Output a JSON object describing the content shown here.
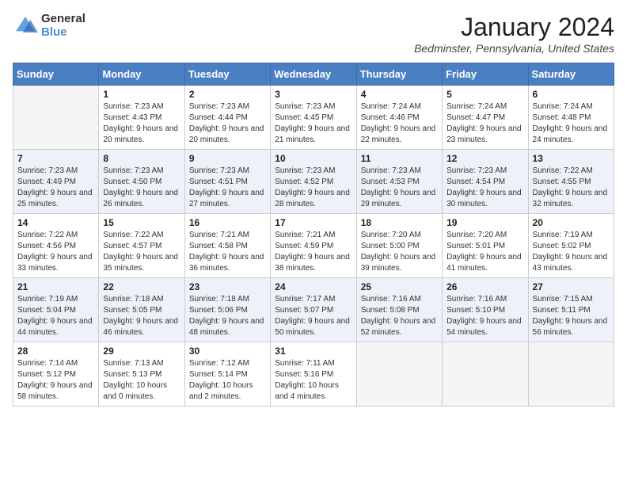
{
  "header": {
    "logo_general": "General",
    "logo_blue": "Blue",
    "month_title": "January 2024",
    "location": "Bedminster, Pennsylvania, United States"
  },
  "days_of_week": [
    "Sunday",
    "Monday",
    "Tuesday",
    "Wednesday",
    "Thursday",
    "Friday",
    "Saturday"
  ],
  "weeks": [
    [
      {
        "day": "",
        "sunrise": "",
        "sunset": "",
        "daylight": "",
        "empty": true
      },
      {
        "day": "1",
        "sunrise": "Sunrise: 7:23 AM",
        "sunset": "Sunset: 4:43 PM",
        "daylight": "Daylight: 9 hours and 20 minutes.",
        "empty": false
      },
      {
        "day": "2",
        "sunrise": "Sunrise: 7:23 AM",
        "sunset": "Sunset: 4:44 PM",
        "daylight": "Daylight: 9 hours and 20 minutes.",
        "empty": false
      },
      {
        "day": "3",
        "sunrise": "Sunrise: 7:23 AM",
        "sunset": "Sunset: 4:45 PM",
        "daylight": "Daylight: 9 hours and 21 minutes.",
        "empty": false
      },
      {
        "day": "4",
        "sunrise": "Sunrise: 7:24 AM",
        "sunset": "Sunset: 4:46 PM",
        "daylight": "Daylight: 9 hours and 22 minutes.",
        "empty": false
      },
      {
        "day": "5",
        "sunrise": "Sunrise: 7:24 AM",
        "sunset": "Sunset: 4:47 PM",
        "daylight": "Daylight: 9 hours and 23 minutes.",
        "empty": false
      },
      {
        "day": "6",
        "sunrise": "Sunrise: 7:24 AM",
        "sunset": "Sunset: 4:48 PM",
        "daylight": "Daylight: 9 hours and 24 minutes.",
        "empty": false
      }
    ],
    [
      {
        "day": "7",
        "sunrise": "Sunrise: 7:23 AM",
        "sunset": "Sunset: 4:49 PM",
        "daylight": "Daylight: 9 hours and 25 minutes.",
        "empty": false
      },
      {
        "day": "8",
        "sunrise": "Sunrise: 7:23 AM",
        "sunset": "Sunset: 4:50 PM",
        "daylight": "Daylight: 9 hours and 26 minutes.",
        "empty": false
      },
      {
        "day": "9",
        "sunrise": "Sunrise: 7:23 AM",
        "sunset": "Sunset: 4:51 PM",
        "daylight": "Daylight: 9 hours and 27 minutes.",
        "empty": false
      },
      {
        "day": "10",
        "sunrise": "Sunrise: 7:23 AM",
        "sunset": "Sunset: 4:52 PM",
        "daylight": "Daylight: 9 hours and 28 minutes.",
        "empty": false
      },
      {
        "day": "11",
        "sunrise": "Sunrise: 7:23 AM",
        "sunset": "Sunset: 4:53 PM",
        "daylight": "Daylight: 9 hours and 29 minutes.",
        "empty": false
      },
      {
        "day": "12",
        "sunrise": "Sunrise: 7:23 AM",
        "sunset": "Sunset: 4:54 PM",
        "daylight": "Daylight: 9 hours and 30 minutes.",
        "empty": false
      },
      {
        "day": "13",
        "sunrise": "Sunrise: 7:22 AM",
        "sunset": "Sunset: 4:55 PM",
        "daylight": "Daylight: 9 hours and 32 minutes.",
        "empty": false
      }
    ],
    [
      {
        "day": "14",
        "sunrise": "Sunrise: 7:22 AM",
        "sunset": "Sunset: 4:56 PM",
        "daylight": "Daylight: 9 hours and 33 minutes.",
        "empty": false
      },
      {
        "day": "15",
        "sunrise": "Sunrise: 7:22 AM",
        "sunset": "Sunset: 4:57 PM",
        "daylight": "Daylight: 9 hours and 35 minutes.",
        "empty": false
      },
      {
        "day": "16",
        "sunrise": "Sunrise: 7:21 AM",
        "sunset": "Sunset: 4:58 PM",
        "daylight": "Daylight: 9 hours and 36 minutes.",
        "empty": false
      },
      {
        "day": "17",
        "sunrise": "Sunrise: 7:21 AM",
        "sunset": "Sunset: 4:59 PM",
        "daylight": "Daylight: 9 hours and 38 minutes.",
        "empty": false
      },
      {
        "day": "18",
        "sunrise": "Sunrise: 7:20 AM",
        "sunset": "Sunset: 5:00 PM",
        "daylight": "Daylight: 9 hours and 39 minutes.",
        "empty": false
      },
      {
        "day": "19",
        "sunrise": "Sunrise: 7:20 AM",
        "sunset": "Sunset: 5:01 PM",
        "daylight": "Daylight: 9 hours and 41 minutes.",
        "empty": false
      },
      {
        "day": "20",
        "sunrise": "Sunrise: 7:19 AM",
        "sunset": "Sunset: 5:02 PM",
        "daylight": "Daylight: 9 hours and 43 minutes.",
        "empty": false
      }
    ],
    [
      {
        "day": "21",
        "sunrise": "Sunrise: 7:19 AM",
        "sunset": "Sunset: 5:04 PM",
        "daylight": "Daylight: 9 hours and 44 minutes.",
        "empty": false
      },
      {
        "day": "22",
        "sunrise": "Sunrise: 7:18 AM",
        "sunset": "Sunset: 5:05 PM",
        "daylight": "Daylight: 9 hours and 46 minutes.",
        "empty": false
      },
      {
        "day": "23",
        "sunrise": "Sunrise: 7:18 AM",
        "sunset": "Sunset: 5:06 PM",
        "daylight": "Daylight: 9 hours and 48 minutes.",
        "empty": false
      },
      {
        "day": "24",
        "sunrise": "Sunrise: 7:17 AM",
        "sunset": "Sunset: 5:07 PM",
        "daylight": "Daylight: 9 hours and 50 minutes.",
        "empty": false
      },
      {
        "day": "25",
        "sunrise": "Sunrise: 7:16 AM",
        "sunset": "Sunset: 5:08 PM",
        "daylight": "Daylight: 9 hours and 52 minutes.",
        "empty": false
      },
      {
        "day": "26",
        "sunrise": "Sunrise: 7:16 AM",
        "sunset": "Sunset: 5:10 PM",
        "daylight": "Daylight: 9 hours and 54 minutes.",
        "empty": false
      },
      {
        "day": "27",
        "sunrise": "Sunrise: 7:15 AM",
        "sunset": "Sunset: 5:11 PM",
        "daylight": "Daylight: 9 hours and 56 minutes.",
        "empty": false
      }
    ],
    [
      {
        "day": "28",
        "sunrise": "Sunrise: 7:14 AM",
        "sunset": "Sunset: 5:12 PM",
        "daylight": "Daylight: 9 hours and 58 minutes.",
        "empty": false
      },
      {
        "day": "29",
        "sunrise": "Sunrise: 7:13 AM",
        "sunset": "Sunset: 5:13 PM",
        "daylight": "Daylight: 10 hours and 0 minutes.",
        "empty": false
      },
      {
        "day": "30",
        "sunrise": "Sunrise: 7:12 AM",
        "sunset": "Sunset: 5:14 PM",
        "daylight": "Daylight: 10 hours and 2 minutes.",
        "empty": false
      },
      {
        "day": "31",
        "sunrise": "Sunrise: 7:11 AM",
        "sunset": "Sunset: 5:16 PM",
        "daylight": "Daylight: 10 hours and 4 minutes.",
        "empty": false
      },
      {
        "day": "",
        "sunrise": "",
        "sunset": "",
        "daylight": "",
        "empty": true
      },
      {
        "day": "",
        "sunrise": "",
        "sunset": "",
        "daylight": "",
        "empty": true
      },
      {
        "day": "",
        "sunrise": "",
        "sunset": "",
        "daylight": "",
        "empty": true
      }
    ]
  ]
}
